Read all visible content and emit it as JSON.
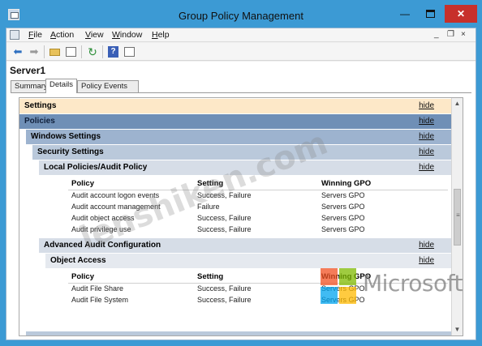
{
  "window": {
    "title": "Group Policy Management"
  },
  "menu": {
    "items": [
      {
        "label": "File",
        "accel": "F",
        "rest": "ile"
      },
      {
        "label": "Action",
        "accel": "A",
        "rest": "ction"
      },
      {
        "label": "View",
        "accel": "V",
        "rest": "iew"
      },
      {
        "label": "Window",
        "accel": "W",
        "rest": "indow"
      },
      {
        "label": "Help",
        "accel": "H",
        "rest": "elp"
      }
    ],
    "mdi_controls": [
      "_",
      "×"
    ]
  },
  "toolbar": {
    "icons": [
      "back-arrow-icon",
      "forward-arrow-icon",
      "up-folder-icon",
      "show-hide-tree-icon",
      "refresh-icon",
      "help-icon",
      "properties-icon"
    ]
  },
  "node": {
    "title": "Server1"
  },
  "tabs": [
    {
      "label": "Summary",
      "active": false
    },
    {
      "label": "Details",
      "active": true
    },
    {
      "label": "Policy Events",
      "active": false
    }
  ],
  "report": {
    "hide_label": "hide",
    "sections": {
      "settings": "Settings",
      "policies": "Policies",
      "windows_settings": "Windows Settings",
      "security_settings": "Security Settings",
      "local_policies": "Local Policies/Audit Policy",
      "advanced_audit": "Advanced Audit Configuration",
      "object_access": "Object Access"
    },
    "columns": [
      "Policy",
      "Setting",
      "Winning GPO"
    ],
    "audit_policy_rows": [
      [
        "Audit account logon events",
        "Success, Failure",
        "Servers GPO"
      ],
      [
        "Audit account management",
        "Failure",
        "Servers GPO"
      ],
      [
        "Audit object access",
        "Success, Failure",
        "Servers GPO"
      ],
      [
        "Audit privilege use",
        "Success, Failure",
        "Servers GPO"
      ]
    ],
    "object_access_rows": [
      [
        "Audit File Share",
        "Success, Failure",
        "Servers GPO"
      ],
      [
        "Audit File System",
        "Success, Failure",
        "Servers GPO"
      ]
    ]
  },
  "watermarks": {
    "site": "lenshiken.com",
    "brand": "Microsoft"
  },
  "colors": {
    "title_bar": "#3c9ad4",
    "close_button": "#c7302b",
    "settings_bar": "#fde8c8",
    "policies_bar": "#6f8fb6"
  }
}
